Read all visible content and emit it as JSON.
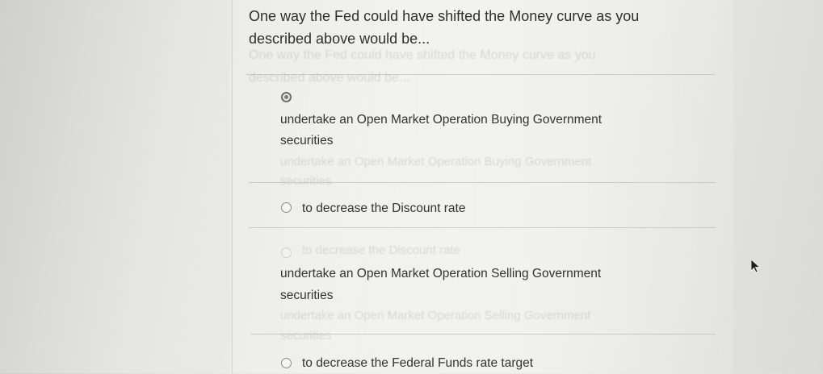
{
  "question": {
    "text": "One way the Fed could have shifted the Money curve as you described above would be..."
  },
  "ghosts": {
    "q1": "One way the Fed could have shifted the Money curve as you",
    "q2": "described above would be...",
    "o1a": "undertake an Open Market Operation Buying Government",
    "o1b": "securities",
    "o2": "to decrease the Discount rate",
    "o3a": "undertake an Open Market Operation Selling Government",
    "o3b": "securities"
  },
  "options": [
    {
      "line1": "undertake an Open Market Operation Buying Government",
      "line2": "securities",
      "selected": true
    },
    {
      "line1": "to decrease the Discount rate",
      "selected": false
    },
    {
      "line1": "undertake an Open Market Operation Selling Government",
      "line2": "securities",
      "selected": false
    },
    {
      "line1": "to decrease the Federal Funds rate target",
      "selected": false
    }
  ]
}
